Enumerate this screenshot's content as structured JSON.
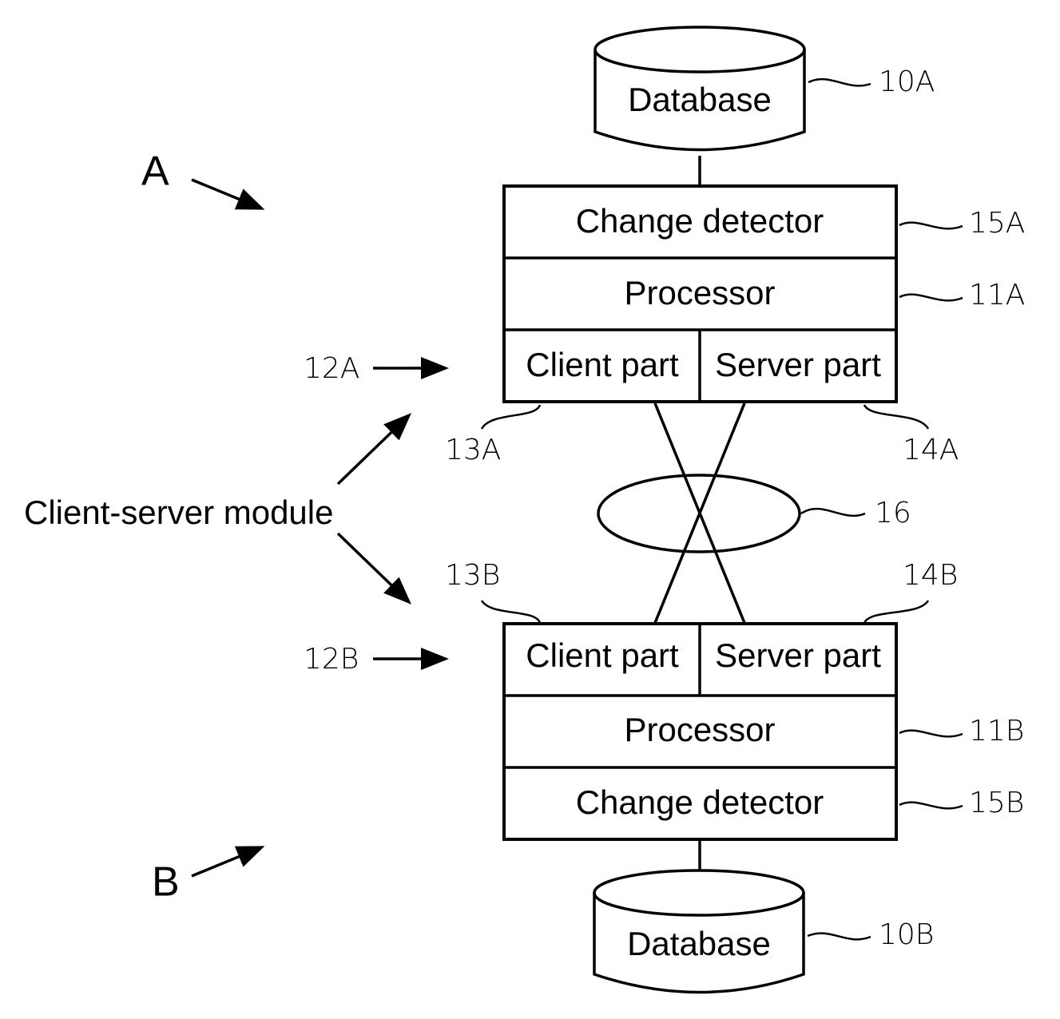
{
  "diagram": {
    "system_labels": {
      "a": "A",
      "b": "B"
    },
    "side_label": "Client-server module",
    "top": {
      "database": "Database",
      "change_detector": "Change detector",
      "processor": "Processor",
      "client_part": "Client part",
      "server_part": "Server part",
      "refs": {
        "database": "10A",
        "change_detector": "15A",
        "processor": "11A",
        "module": "12A",
        "client": "13A",
        "server": "14A"
      }
    },
    "bottom": {
      "database": "Database",
      "change_detector": "Change detector",
      "processor": "Processor",
      "client_part": "Client part",
      "server_part": "Server part",
      "refs": {
        "database": "10B",
        "change_detector": "15B",
        "processor": "11B",
        "module": "12B",
        "client": "13B",
        "server": "14B"
      }
    },
    "network_ref": "16"
  }
}
